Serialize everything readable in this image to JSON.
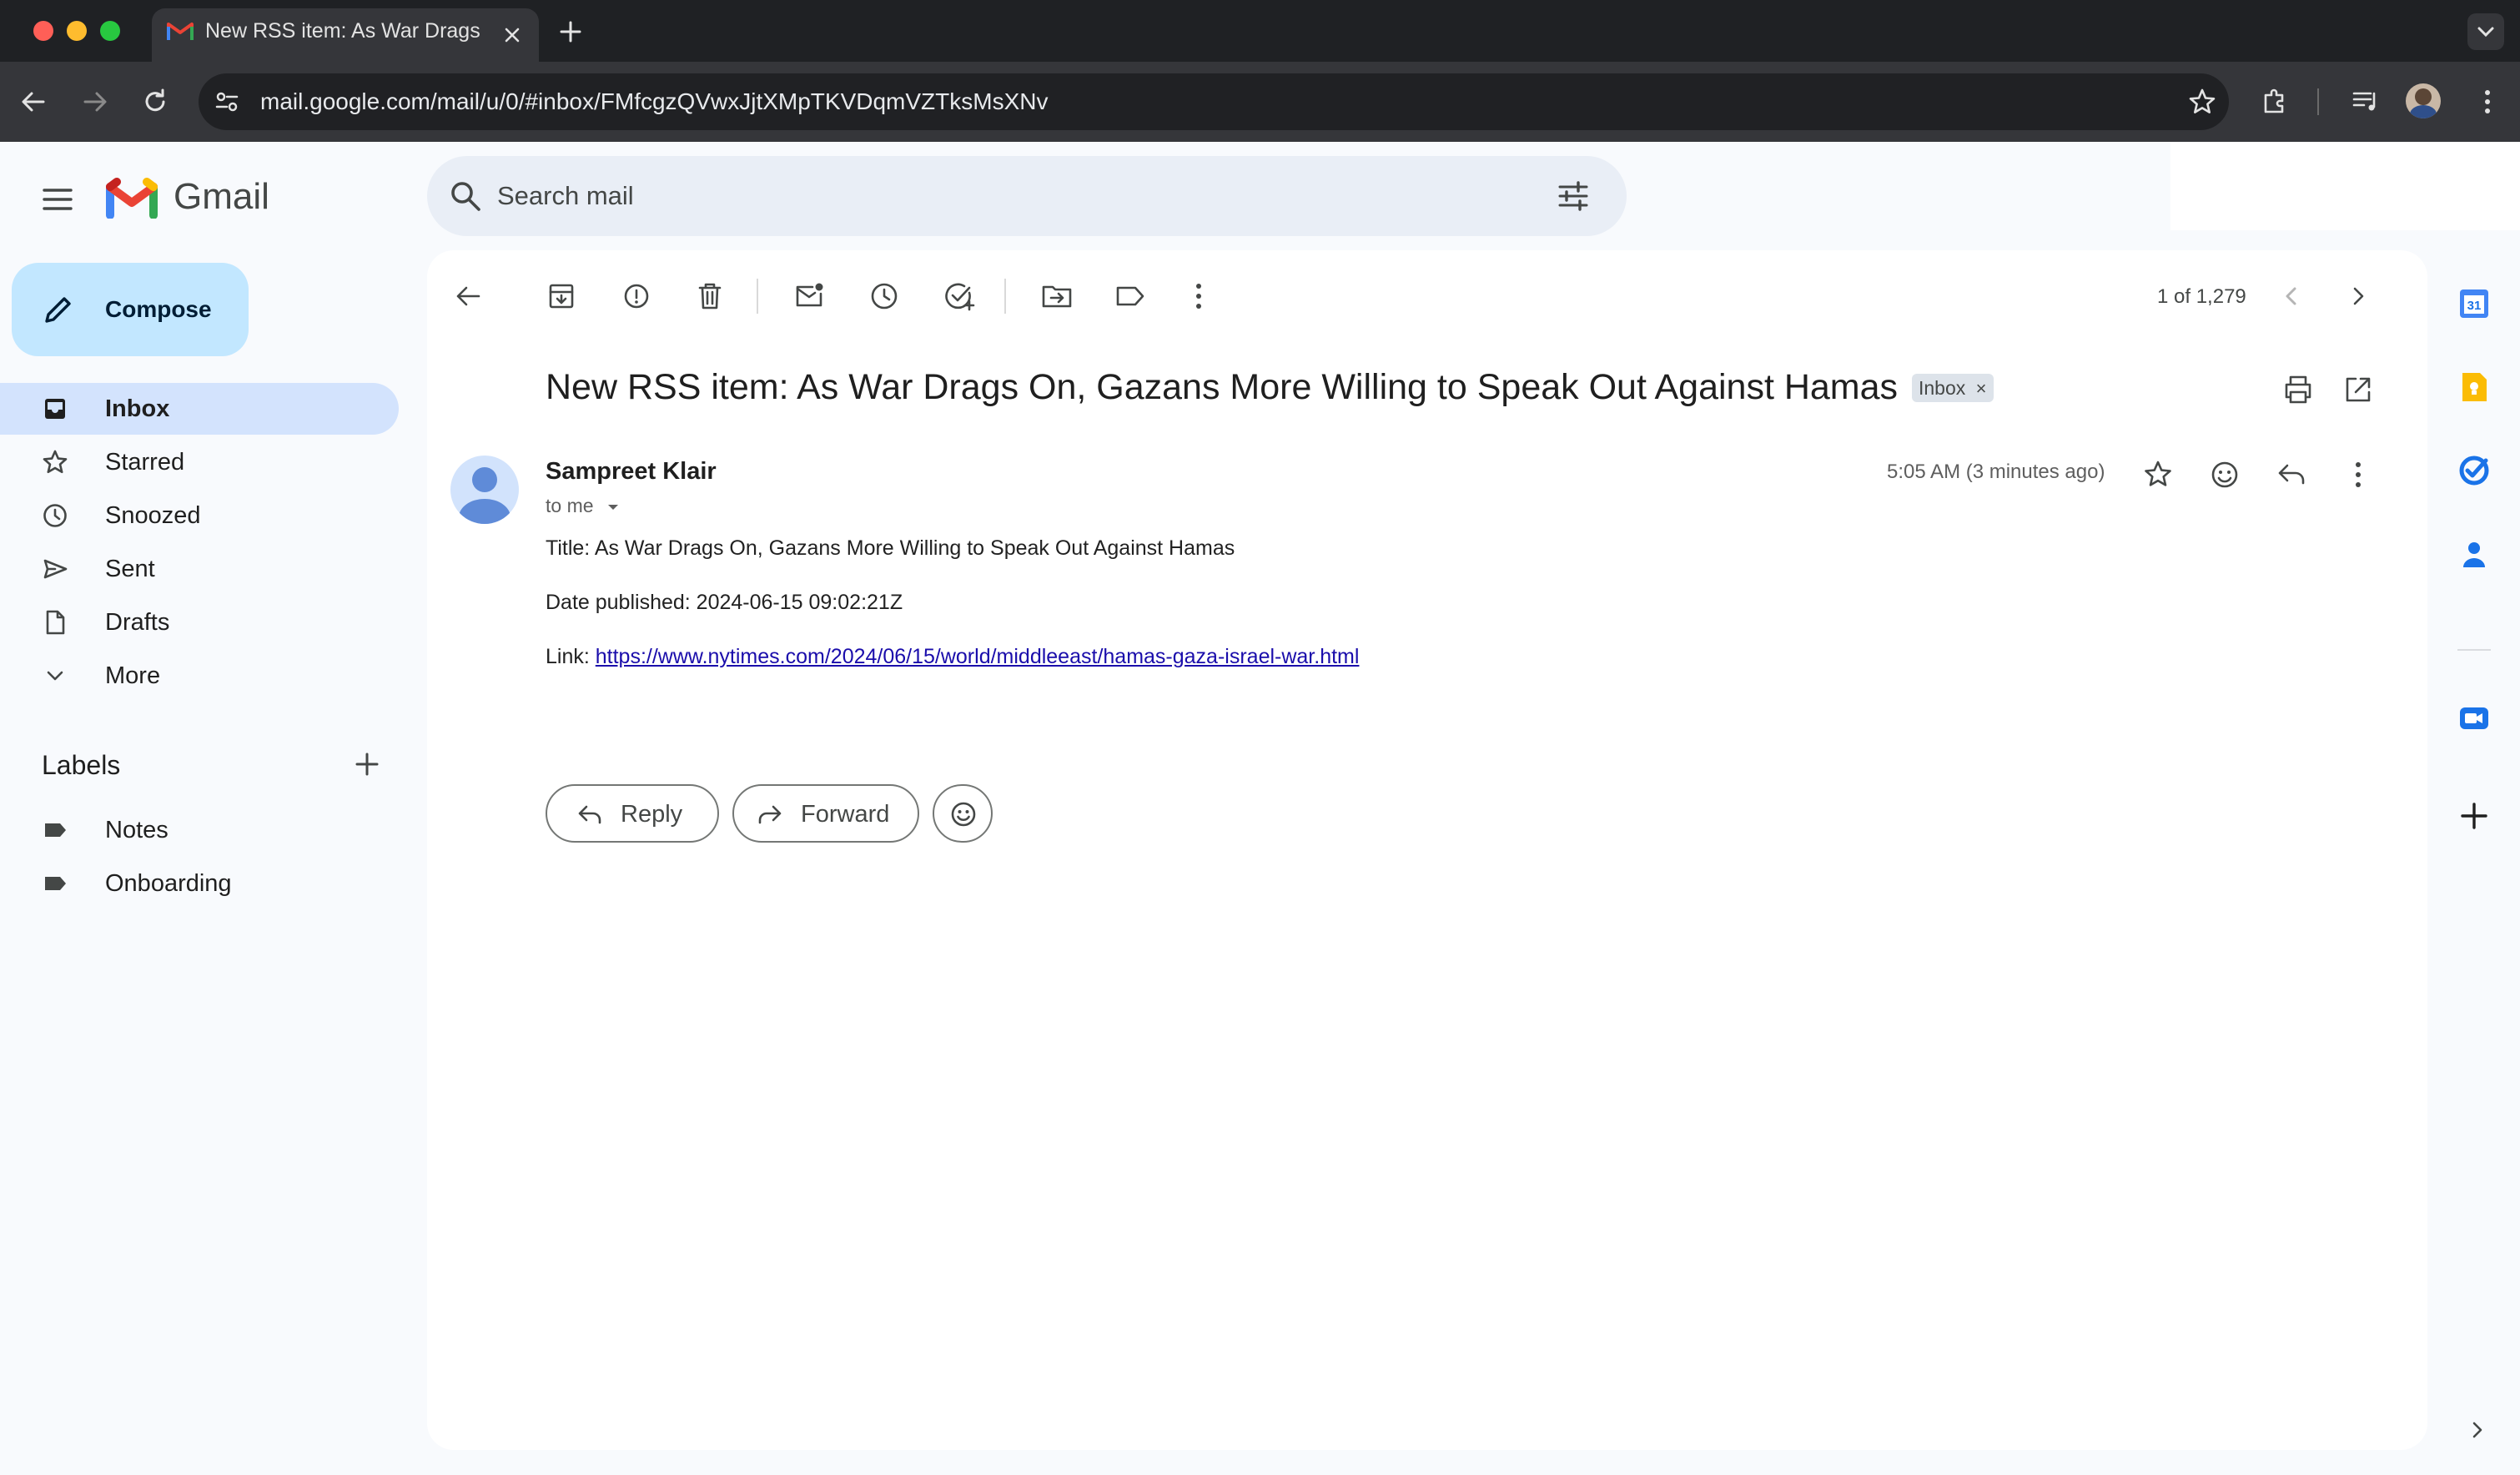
{
  "browser": {
    "tab_title": "New RSS item: As War Drags On, Gazans More Willing to Speak Out Against Hamas",
    "url": "mail.google.com/mail/u/0/#inbox/FMfcgzQVwxJjtXMpTKVDqmVZTksMsXNv"
  },
  "gmail": {
    "brand": "Gmail",
    "search_placeholder": "Search mail",
    "compose_label": "Compose",
    "nav": [
      {
        "label": "Inbox",
        "icon": "inbox-icon",
        "selected": true
      },
      {
        "label": "Starred",
        "icon": "star-icon"
      },
      {
        "label": "Snoozed",
        "icon": "clock-icon"
      },
      {
        "label": "Sent",
        "icon": "send-icon"
      },
      {
        "label": "Drafts",
        "icon": "draft-icon"
      },
      {
        "label": "More",
        "icon": "chevron-down-icon"
      }
    ],
    "labels_heading": "Labels",
    "labels": [
      {
        "label": "Notes"
      },
      {
        "label": "Onboarding"
      }
    ],
    "pagination": "1 of 1,279"
  },
  "email": {
    "subject": "New RSS item: As War Drags On, Gazans More Willing to Speak Out Against Hamas",
    "label_chip": "Inbox",
    "chip_close": "×",
    "sender": "Sampreet Klair",
    "to": "to me",
    "time": "5:05 AM (3 minutes ago)",
    "body": {
      "title_line": "Title: As War Drags On, Gazans More Willing to Speak Out Against Hamas",
      "date_line": "Date published: 2024-06-15 09:02:21Z",
      "link_prefix": "Link: ",
      "link_url": "https://www.nytimes.com/2024/06/15/world/middleeast/hamas-gaza-israel-war.html"
    },
    "reply_label": "Reply",
    "forward_label": "Forward"
  },
  "side_panel": {
    "calendar_day": "31"
  },
  "colors": {
    "accent": "#0b57d0",
    "compose_bg": "#c2e7ff",
    "selected_nav_bg": "#d3e3fd",
    "link": "#1a0dab"
  }
}
